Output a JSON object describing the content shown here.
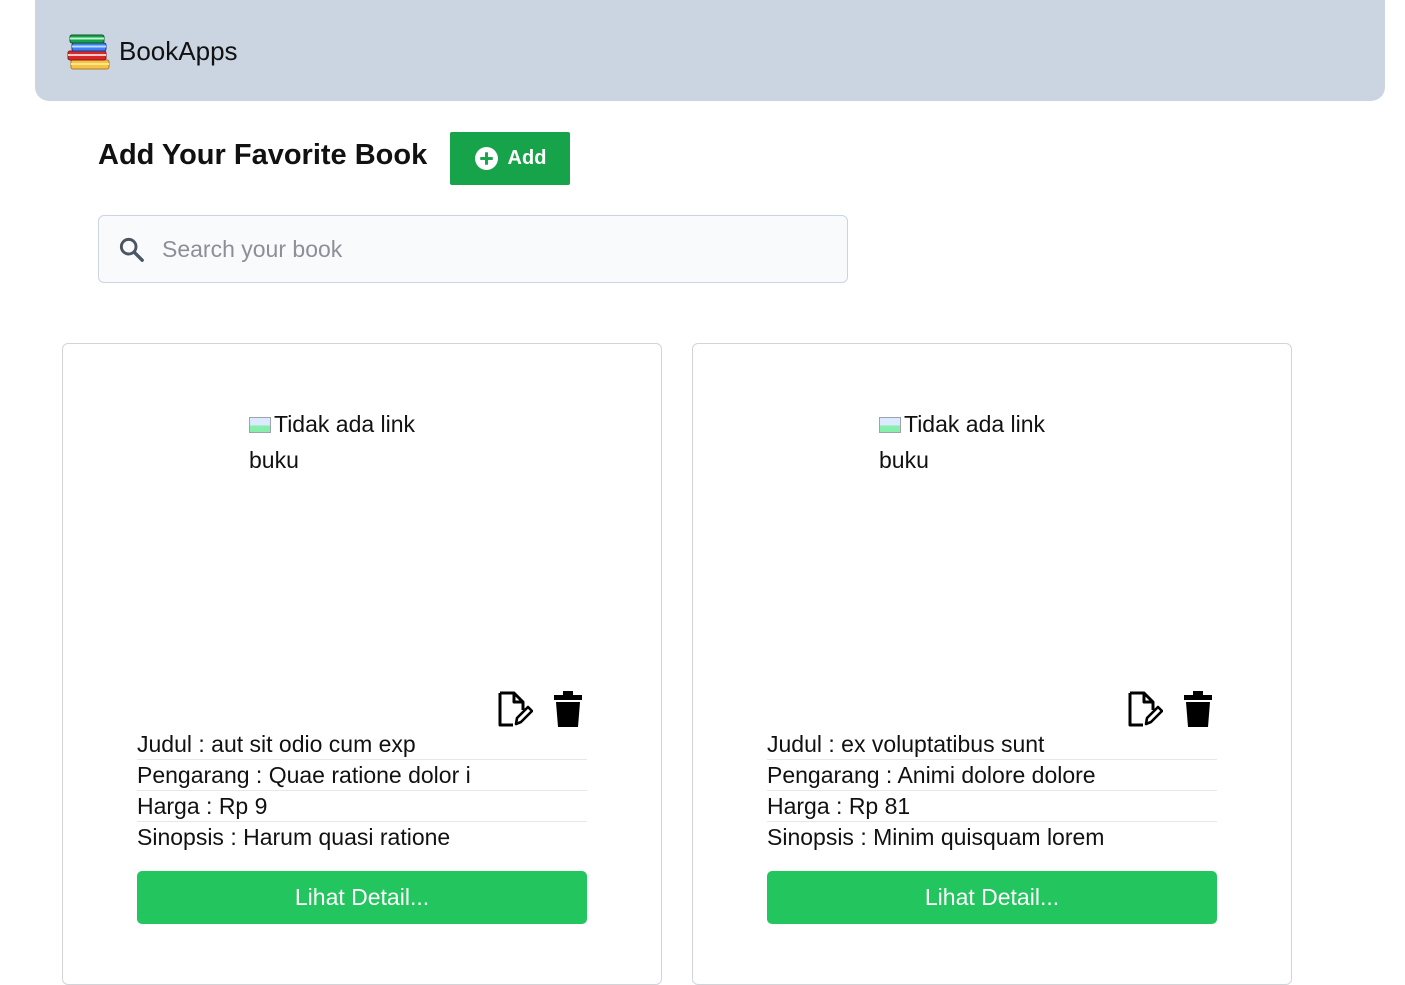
{
  "navbar": {
    "brand": "BookApps",
    "logo_icon": "books-stack-icon"
  },
  "header": {
    "title": "Add Your Favorite Book",
    "add_button_label": "Add",
    "add_icon": "plus-circle-icon"
  },
  "search": {
    "placeholder": "Search your book",
    "value": "",
    "icon": "search-icon"
  },
  "colors": {
    "navbar_bg": "#cbd5e1",
    "add_button": "#16a34a",
    "detail_button": "#22c55e"
  },
  "books": [
    {
      "cover_alt": "Tidak ada link buku",
      "judul": "Judul : aut sit odio cum exp",
      "pengarang": "Pengarang : Quae ratione dolor i",
      "harga": "Harga : Rp 9",
      "sinopsis": "Sinopsis : Harum quasi ratione",
      "detail_label": "Lihat Detail...",
      "edit_icon": "edit-file-icon",
      "delete_icon": "trash-icon"
    },
    {
      "cover_alt": "Tidak ada link buku",
      "judul": "Judul : ex voluptatibus sunt",
      "pengarang": "Pengarang : Animi dolore dolore",
      "harga": "Harga : Rp 81",
      "sinopsis": "Sinopsis : Minim quisquam lorem",
      "detail_label": "Lihat Detail...",
      "edit_icon": "edit-file-icon",
      "delete_icon": "trash-icon"
    }
  ]
}
